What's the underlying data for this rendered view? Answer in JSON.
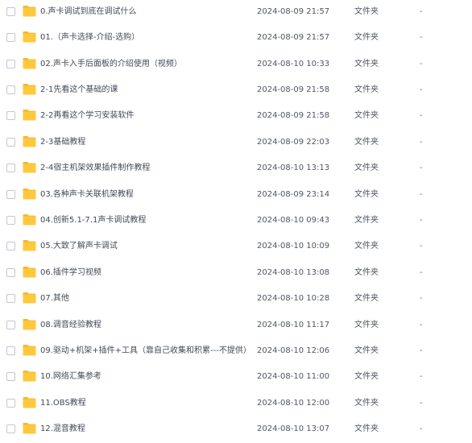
{
  "file_list": {
    "items": [
      {
        "name": "0.声卡调试到底在调试什么",
        "date": "2024-08-09 21:57",
        "type": "文件夹",
        "size": "-"
      },
      {
        "name": "01.（声卡选择-介绍-选购）",
        "date": "2024-08-09 21:57",
        "type": "文件夹",
        "size": "-"
      },
      {
        "name": "02.声卡入手后面板的介绍使用（视频）",
        "date": "2024-08-10 10:33",
        "type": "文件夹",
        "size": "-"
      },
      {
        "name": "2-1先看这个基础的课",
        "date": "2024-08-09 21:58",
        "type": "文件夹",
        "size": "-"
      },
      {
        "name": "2-2再看这个学习安装软件",
        "date": "2024-08-09 21:58",
        "type": "文件夹",
        "size": "-"
      },
      {
        "name": "2-3基础教程",
        "date": "2024-08-09 22:03",
        "type": "文件夹",
        "size": "-"
      },
      {
        "name": "2-4宿主机架效果插件制作教程",
        "date": "2024-08-10 13:13",
        "type": "文件夹",
        "size": "-"
      },
      {
        "name": "03.各种声卡关联机架教程",
        "date": "2024-08-09 23:14",
        "type": "文件夹",
        "size": "-"
      },
      {
        "name": "04.创新5.1-7.1声卡调试教程",
        "date": "2024-08-10 09:43",
        "type": "文件夹",
        "size": "-"
      },
      {
        "name": "05.大致了解声卡调试",
        "date": "2024-08-10 10:09",
        "type": "文件夹",
        "size": "-"
      },
      {
        "name": "06.插件学习视频",
        "date": "2024-08-10 13:08",
        "type": "文件夹",
        "size": "-"
      },
      {
        "name": "07.其他",
        "date": "2024-08-10 10:28",
        "type": "文件夹",
        "size": "-"
      },
      {
        "name": "08.调音经验教程",
        "date": "2024-08-10 11:17",
        "type": "文件夹",
        "size": "-"
      },
      {
        "name": "09.驱动+机架+插件+工具（靠自己收集和积累---不提供）",
        "date": "2024-08-10 12:06",
        "type": "文件夹",
        "size": "-"
      },
      {
        "name": "10.网络汇集参考",
        "date": "2024-08-10 11:00",
        "type": "文件夹",
        "size": "-"
      },
      {
        "name": "11.OBS教程",
        "date": "2024-08-10 12:00",
        "type": "文件夹",
        "size": "-"
      },
      {
        "name": "12.混音教程",
        "date": "2024-08-10 13:07",
        "type": "文件夹",
        "size": "-"
      }
    ],
    "icon": "folder-icon",
    "colors": {
      "folder_body": "#ffc83d",
      "folder_tab": "#f5b82e",
      "checkbox_border": "#c2c7d0",
      "text": "#424a57"
    }
  }
}
